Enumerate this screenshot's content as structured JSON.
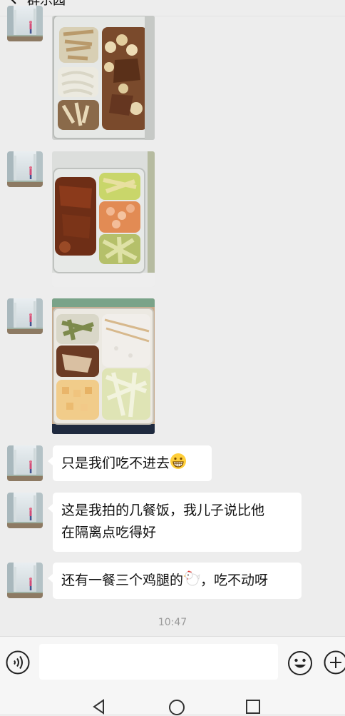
{
  "header": {
    "title": "群乐园"
  },
  "messages": [
    {
      "type": "image",
      "alt": "盒饭：鸡蛋红烧肉、洋葱、蘑菇"
    },
    {
      "type": "image",
      "alt": "盒饭：排骨、虾仁蔬菜、菜心"
    },
    {
      "type": "image",
      "alt": "盒饭：青菜、米饭、鸡肉、土豆、白菜"
    },
    {
      "type": "text",
      "text": "只是我们吃不进去",
      "emoji": "grinning-face-emoji"
    },
    {
      "type": "text",
      "lines": [
        "这是我拍的几餐饭，我儿子说比他",
        "在隔离点吃得好"
      ]
    },
    {
      "type": "text",
      "before": "还有一餐三个鸡腿的",
      "emoji": "chicken-emoji",
      "after": "，吃不动呀"
    }
  ],
  "timestamp": "10:47",
  "input": {
    "value": ""
  },
  "icons": {
    "voice": "voice-input-icon",
    "emoji": "emoji-icon",
    "more": "plus-icon",
    "back": "back-icon",
    "home": "home-icon",
    "recent": "recent-apps-icon"
  },
  "colors": {
    "background": "#ededed",
    "bubble": "#ffffff",
    "bar": "#f6f6f6"
  }
}
